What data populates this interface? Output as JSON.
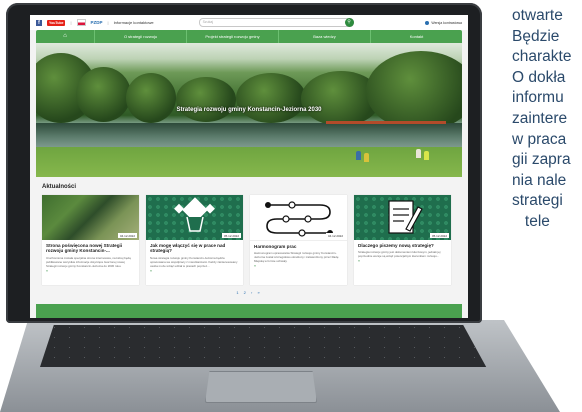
{
  "background_text": {
    "lines": [
      "otwarte",
      "Będzie",
      "charakte",
      "O dokła",
      "informu",
      "zaintere",
      "w praca",
      "gii zapra",
      "nia nale",
      "strategi",
      "   tele"
    ]
  },
  "topbar": {
    "facebook": "f",
    "youtube": "YouTube",
    "pzdp_logo": "PZDP",
    "accessibility_text": "Informacje kontaktowe",
    "search_placeholder": "Szukaj",
    "login_label": "Wersja kontrastowa"
  },
  "nav": {
    "items": [
      "O strategii rozwoju",
      "Projekt strategii rozwoju gminy",
      "Baza wiedzy",
      "Kontakt"
    ]
  },
  "hero": {
    "title": "Strategia rozwoju gminy Konstancin-Jeziorna 2030"
  },
  "news": {
    "heading": "Aktualności",
    "cards": [
      {
        "date": "04.12.2022",
        "title": "Strona poświęcona nowej Strategii rozwoju gminy Konstancin-...",
        "text": "Uruchomiona została specjalna strona internetowa, na której będą publikowane wszystkie informacje dotyczące tworzonej nowej Strategii rozwoju gminy Konstancin-Jeziorna do 2030 roku.",
        "more": "»"
      },
      {
        "date": "05.12.2022",
        "title": "Jak mogę włączyć się w prace nad strategią?",
        "text": "Nowa strategia rozwoju gminy Konstancin-Jeziorna będzie opracowana we współpracy z mieszkańcami. Każdy zainteresowany osoba może wziąć udział w pracach poprzez...",
        "more": "»"
      },
      {
        "date": "04.12.2022",
        "title": "Harmonogram prac",
        "text": "Harmonogram opracowania Strategii rozwoju gminy Konstancin-Jeziorna został szczegółowo określony i zatwierdzony przez Radę Miejską w formie uchwały.",
        "more": "»"
      },
      {
        "date": "05.12.2022",
        "title": "Dlaczego piszemy nową strategię?",
        "text": "Strategia rozwoju gminy jest dokumentem kluczowym, jednak jej poprzednie wersje są wciąż potencjalnym kierunkiem rozwoju...",
        "more": "»"
      }
    ],
    "pager": "1 2 › »"
  }
}
